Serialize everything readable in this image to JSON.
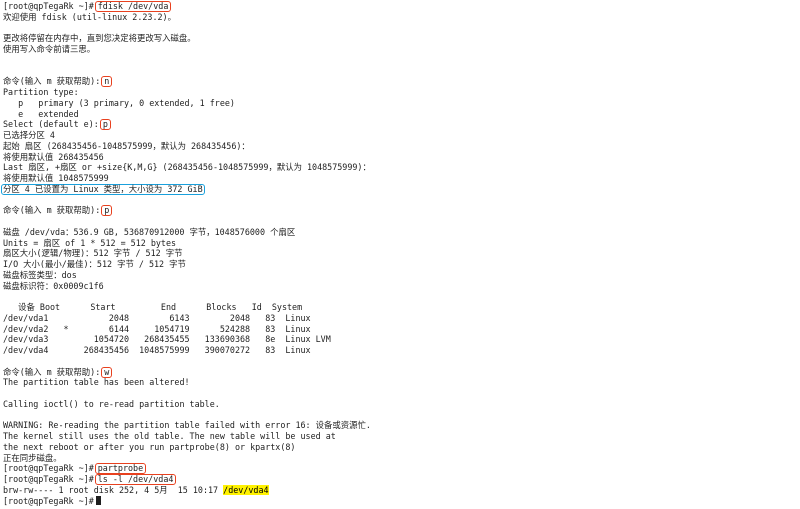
{
  "terminal": {
    "lines": [
      {
        "text": "[root@qpTegaRk ~]#",
        "cmd": "fdisk /dev/vda"
      },
      {
        "text": "欢迎使用 fdisk (util-linux 2.23.2)。"
      },
      {
        "text": ""
      },
      {
        "text": "更改将停留在内存中，直到您决定将更改写入磁盘。"
      },
      {
        "text": "使用写入命令前请三思。"
      },
      {
        "text": ""
      },
      {
        "text": ""
      },
      {
        "text": "命令(输入 m 获取帮助):",
        "cmd": "n"
      },
      {
        "text": "Partition type:"
      },
      {
        "text": "   p   primary (3 primary, 0 extended, 1 free)"
      },
      {
        "text": "   e   extended"
      },
      {
        "text": "Select (default e):",
        "cmd": "p"
      },
      {
        "text": "已选择分区 4"
      },
      {
        "text": "起始 扇区 (268435456-1048575999，默认为 268435456)："
      },
      {
        "text": "将使用默认值 268435456"
      },
      {
        "text": "Last 扇区, +扇区 or +size{K,M,G} (268435456-1048575999，默认为 1048575999)："
      },
      {
        "text": "将使用默认值 1048575999"
      },
      {
        "box": "分区 4 已设置为 Linux 类型，大小设为 372 GiB"
      },
      {
        "text": ""
      },
      {
        "text": "命令(输入 m 获取帮助):",
        "cmd": "p"
      },
      {
        "text": ""
      },
      {
        "text": "磁盘 /dev/vda：536.9 GB, 536870912000 字节，1048576000 个扇区"
      },
      {
        "text": "Units = 扇区 of 1 * 512 = 512 bytes"
      },
      {
        "text": "扇区大小(逻辑/物理)：512 字节 / 512 字节"
      },
      {
        "text": "I/O 大小(最小/最佳)：512 字节 / 512 字节"
      },
      {
        "text": "磁盘标签类型：dos"
      },
      {
        "text": "磁盘标识符：0x0009c1f6"
      },
      {
        "text": ""
      },
      {
        "text": "   设备 Boot      Start         End      Blocks   Id  System"
      },
      {
        "text": "/dev/vda1            2048        6143        2048   83  Linux"
      },
      {
        "text": "/dev/vda2   *        6144     1054719      524288   83  Linux"
      },
      {
        "text": "/dev/vda3         1054720   268435455   133690368   8e  Linux LVM"
      },
      {
        "text": "/dev/vda4       268435456  1048575999   390070272   83  Linux"
      },
      {
        "text": ""
      },
      {
        "text": "命令(输入 m 获取帮助):",
        "cmd": "w"
      },
      {
        "text": "The partition table has been altered!"
      },
      {
        "text": ""
      },
      {
        "text": "Calling ioctl() to re-read partition table."
      },
      {
        "text": ""
      },
      {
        "text": "WARNING: Re-reading the partition table failed with error 16: 设备或资源忙."
      },
      {
        "text": "The kernel still uses the old table. The new table will be used at"
      },
      {
        "text": "the next reboot or after you run partprobe(8) or kpartx(8)"
      },
      {
        "text": "正在同步磁盘。"
      },
      {
        "text": "[root@qpTegaRk ~]#",
        "cmd": "partprobe"
      },
      {
        "text": "[root@qpTegaRk ~]#",
        "cmd": "ls -l /dev/vda4"
      },
      {
        "text": "brw-rw---- 1 root disk 252, 4 5月  15 10:17 ",
        "selected": "/dev/vda4"
      },
      {
        "text": "[root@qpTegaRk ~]#",
        "cursor": true
      }
    ]
  }
}
